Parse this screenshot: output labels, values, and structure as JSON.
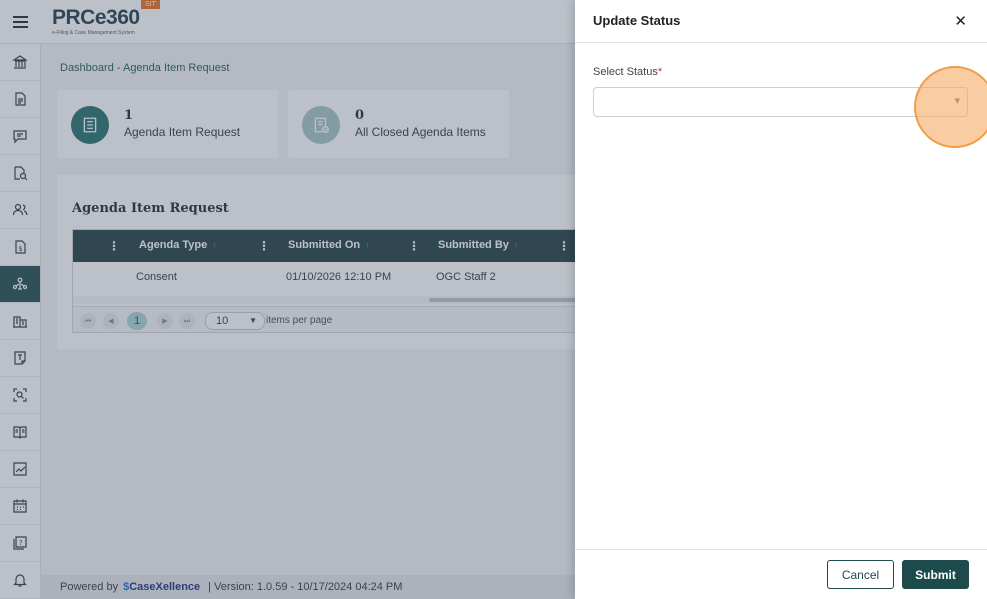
{
  "header": {
    "logo_text": "PRCe360",
    "logo_subtitle": "e-Filing & Case Management System",
    "env_badge": "SIT"
  },
  "sidebar": {
    "items": [
      {
        "icon": "institution-icon"
      },
      {
        "icon": "document-icon"
      },
      {
        "icon": "chat-icon"
      },
      {
        "icon": "document-search-icon"
      },
      {
        "icon": "users-icon"
      },
      {
        "icon": "billing-document-icon"
      },
      {
        "icon": "agenda-network-icon",
        "active": true
      },
      {
        "icon": "building-icon"
      },
      {
        "icon": "template-icon"
      },
      {
        "icon": "scan-search-icon"
      },
      {
        "icon": "book-icon"
      },
      {
        "icon": "chart-icon"
      },
      {
        "icon": "calendar-icon"
      },
      {
        "icon": "help-document-icon"
      },
      {
        "icon": "bell-icon"
      }
    ]
  },
  "breadcrumb": "Dashboard - Agenda Item Request",
  "cards": [
    {
      "count": "1",
      "label": "Agenda Item Request",
      "color": "#1e6e6b"
    },
    {
      "count": "0",
      "label": "All Closed Agenda Items",
      "color": "#a3c4c2"
    }
  ],
  "panel": {
    "title": "Agenda Item Request",
    "columns": [
      "Agenda Type",
      "Submitted On",
      "Submitted By"
    ],
    "rows": [
      {
        "agenda_type": "Consent",
        "submitted_on": "01/10/2026 12:10 PM",
        "submitted_by": "OGC Staff 2"
      }
    ],
    "pager": {
      "current_page": "1",
      "page_size": "10",
      "items_per_page_label": "items per page"
    }
  },
  "footer": {
    "powered_by": "Powered by",
    "brand": "CaseXellence",
    "version": "|  Version: 1.0.59 - 10/17/2024 04:24 PM"
  },
  "drawer": {
    "title": "Update Status",
    "close_symbol": "✕",
    "field_label": "Select Status",
    "required_mark": "*",
    "select_value": "",
    "cancel_label": "Cancel",
    "submit_label": "Submit"
  },
  "colors": {
    "primary": "#1d4b4c",
    "accent_orange": "#f39c48",
    "required_red": "#d6312c"
  }
}
